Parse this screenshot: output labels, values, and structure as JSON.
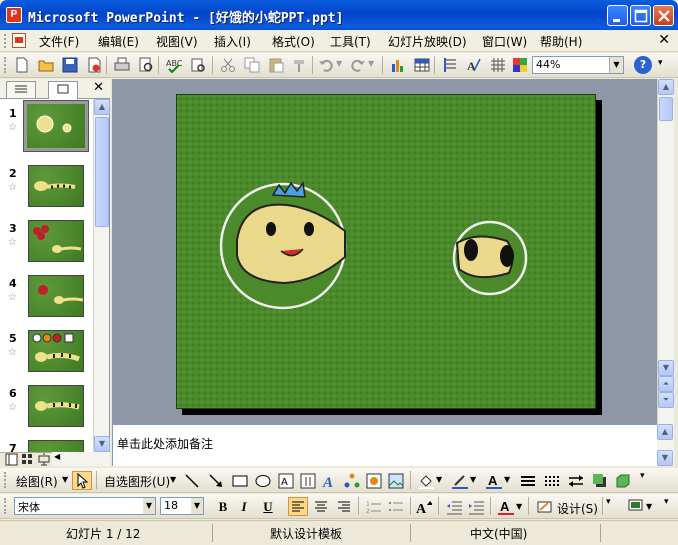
{
  "window": {
    "title": "Microsoft PowerPoint - [好饿的小蛇PPT.ppt]",
    "app_icon_letter": "P"
  },
  "menu": {
    "items": [
      "文件(F)",
      "编辑(E)",
      "视图(V)",
      "插入(I)",
      "格式(O)",
      "工具(T)",
      "幻灯片放映(D)",
      "窗口(W)",
      "帮助(H)"
    ]
  },
  "standard_toolbar": {
    "zoom": "44%",
    "help_label": "?"
  },
  "slides_pane": {
    "thumbs": [
      {
        "num": "1"
      },
      {
        "num": "2"
      },
      {
        "num": "3"
      },
      {
        "num": "4"
      },
      {
        "num": "5"
      },
      {
        "num": "6"
      },
      {
        "num": "7"
      }
    ],
    "selected": 1
  },
  "notes": {
    "placeholder": "单击此处添加备注"
  },
  "drawing_toolbar": {
    "draw_label": "绘图(R)",
    "autoshape_label": "自选图形(U)"
  },
  "format_toolbar": {
    "font": "宋体",
    "size": "18",
    "bold": "B",
    "italic": "I",
    "underline": "U",
    "design_label": "设计(S)"
  },
  "status": {
    "slide": "幻灯片 1 / 12",
    "template": "默认设计模板",
    "language": "中文(中国)"
  },
  "colors": {
    "titlebar": "#0444c8",
    "slide_bg": "#3f8422",
    "stage_bg": "#8d97a8"
  }
}
